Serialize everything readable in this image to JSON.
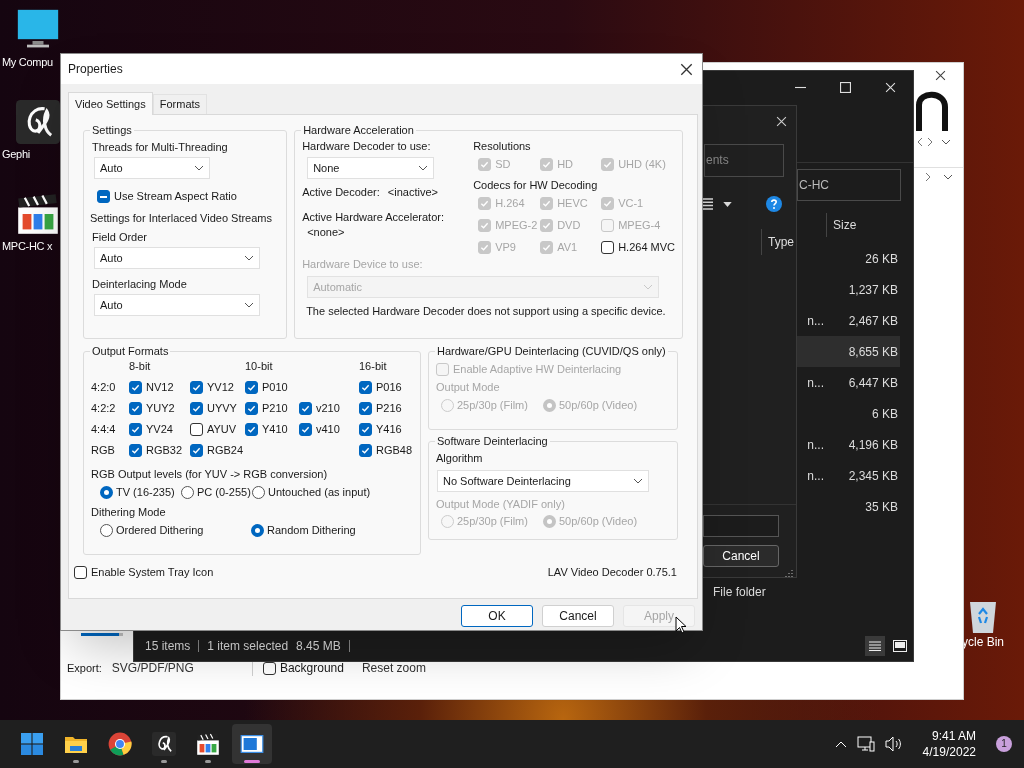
{
  "desktop": {
    "icons": [
      {
        "kind": "monitor",
        "label": "My Compu"
      },
      {
        "kind": "gephi",
        "label": "Gephi"
      },
      {
        "kind": "player",
        "label": "MPC-HC x"
      }
    ],
    "recycle_bin": {
      "label": "ycle Bin"
    }
  },
  "gephi_window": {
    "zoom_slider": {
      "level": 0.9
    },
    "export_label": "Export:",
    "export_value": "SVG/PDF/PNG",
    "background_option": {
      "label": "Background",
      "checked": false
    },
    "reset_zoom": "Reset zoom"
  },
  "explorer_window": {
    "address": "C-HC",
    "size_header": "Size",
    "rows": [
      {
        "size": "26 KB",
        "selected": false
      },
      {
        "size": "1,237 KB",
        "selected": false
      },
      {
        "type": "n...",
        "size": "2,467 KB",
        "selected": false
      },
      {
        "size": "8,655 KB",
        "selected": true
      },
      {
        "type": "n...",
        "size": "6,447 KB",
        "selected": false
      },
      {
        "size": "6 KB",
        "selected": false
      },
      {
        "type": "n...",
        "size": "4,196 KB",
        "selected": false
      },
      {
        "type": "n...",
        "size": "2,345 KB",
        "selected": false
      },
      {
        "size": "35 KB",
        "selected": false
      }
    ],
    "folder_row": {
      "type": "File folder"
    },
    "status": {
      "count": "15 items",
      "selection": "1 item selected",
      "selection_size": "8.45 MB"
    }
  },
  "file_dialog": {
    "search_placeholder": "ents",
    "type_header": "Type",
    "cancel": "Cancel"
  },
  "dialog": {
    "title": "Properties",
    "tabs": [
      {
        "label": "Video Settings",
        "selected": true
      },
      {
        "label": "Formats",
        "selected": false
      }
    ],
    "settings": {
      "title": "Settings",
      "threads": {
        "label": "Threads for Multi-Threading",
        "value": "Auto"
      },
      "stream_aspect": {
        "label": "Use Stream Aspect Ratio",
        "checked": true,
        "indeterminate": true
      },
      "interlaced_title": "Settings for Interlaced Video Streams",
      "field_order": {
        "label": "Field Order",
        "value": "Auto"
      },
      "deint_mode": {
        "label": "Deinterlacing Mode",
        "value": "Auto"
      }
    },
    "hw": {
      "title": "Hardware Acceleration",
      "decoder": {
        "label": "Hardware Decoder to use:",
        "value": "None"
      },
      "active_decoder": {
        "label": "Active Decoder:",
        "value": "<inactive>"
      },
      "active_accelerator": {
        "label": "Active Hardware Accelerator:",
        "value": "<none>"
      },
      "device": {
        "label": "Hardware Device to use:",
        "value": "Automatic",
        "disabled": true
      },
      "note": "The selected Hardware Decoder does not support using a specific device.",
      "resolutions": {
        "title": "Resolutions",
        "items": [
          {
            "label": "SD",
            "checked": true,
            "disabled": true
          },
          {
            "label": "HD",
            "checked": true,
            "disabled": true
          },
          {
            "label": "UHD (4K)",
            "checked": true,
            "disabled": true
          }
        ]
      },
      "codecs": {
        "title": "Codecs for HW Decoding",
        "items": [
          {
            "label": "H.264",
            "checked": true,
            "disabled": true
          },
          {
            "label": "HEVC",
            "checked": true,
            "disabled": true
          },
          {
            "label": "VC-1",
            "checked": true,
            "disabled": true
          },
          {
            "label": "MPEG-2",
            "checked": true,
            "disabled": true
          },
          {
            "label": "DVD",
            "checked": true,
            "disabled": true
          },
          {
            "label": "MPEG-4",
            "checked": false,
            "disabled": true
          },
          {
            "label": "VP9",
            "checked": true,
            "disabled": true
          },
          {
            "label": "AV1",
            "checked": true,
            "disabled": true
          },
          {
            "label": "H.264 MVC",
            "checked": false,
            "disabled": false
          }
        ]
      }
    },
    "output": {
      "title": "Output Formats",
      "bit_headers": [
        "8-bit",
        "10-bit",
        "16-bit"
      ],
      "rows": [
        {
          "label": "4:2:0",
          "cells": [
            {
              "label": "NV12",
              "checked": true
            },
            {
              "label": "YV12",
              "checked": true
            },
            {
              "label": "P010",
              "checked": true
            },
            null,
            {
              "label": "P016",
              "checked": true
            }
          ]
        },
        {
          "label": "4:2:2",
          "cells": [
            {
              "label": "YUY2",
              "checked": true
            },
            {
              "label": "UYVY",
              "checked": true
            },
            {
              "label": "P210",
              "checked": true
            },
            {
              "label": "v210",
              "checked": true
            },
            {
              "label": "P216",
              "checked": true
            }
          ]
        },
        {
          "label": "4:4:4",
          "cells": [
            {
              "label": "YV24",
              "checked": true
            },
            {
              "label": "AYUV",
              "checked": false
            },
            {
              "label": "Y410",
              "checked": true
            },
            {
              "label": "v410",
              "checked": true
            },
            {
              "label": "Y416",
              "checked": true
            }
          ]
        },
        {
          "label": "RGB",
          "cells": [
            {
              "label": "RGB32",
              "checked": true
            },
            {
              "label": "RGB24",
              "checked": true
            },
            null,
            null,
            {
              "label": "RGB48",
              "checked": true
            }
          ]
        }
      ],
      "rgb_levels": {
        "title": "RGB Output levels (for YUV -> RGB conversion)",
        "options": [
          {
            "label": "TV (16-235)",
            "selected": true
          },
          {
            "label": "PC (0-255)",
            "selected": false
          },
          {
            "label": "Untouched (as input)",
            "selected": false
          }
        ]
      },
      "dithering": {
        "title": "Dithering Mode",
        "options": [
          {
            "label": "Ordered Dithering",
            "selected": false
          },
          {
            "label": "Random Dithering",
            "selected": true
          }
        ]
      }
    },
    "hw_deint": {
      "title": "Hardware/GPU Deinterlacing (CUVID/QS only)",
      "adaptive": {
        "label": "Enable Adaptive HW Deinterlacing",
        "checked": false,
        "disabled": true
      },
      "output_mode": {
        "label": "Output Mode",
        "disabled": true,
        "options": [
          {
            "label": "25p/30p (Film)",
            "selected": false
          },
          {
            "label": "50p/60p (Video)",
            "selected": true
          }
        ]
      }
    },
    "sw_deint": {
      "title": "Software Deinterlacing",
      "algorithm": {
        "label": "Algorithm",
        "value": "No Software Deinterlacing"
      },
      "output_mode": {
        "label": "Output Mode (YADIF only)",
        "disabled": true,
        "options": [
          {
            "label": "25p/30p (Film)",
            "selected": false
          },
          {
            "label": "50p/60p (Video)",
            "selected": true
          }
        ]
      }
    },
    "tray_icon": {
      "label": "Enable System Tray Icon",
      "checked": false
    },
    "version": "LAV Video Decoder 0.75.1",
    "buttons": [
      {
        "label": "OK",
        "kind": "default",
        "disabled": false
      },
      {
        "label": "Cancel",
        "kind": "normal",
        "disabled": false
      },
      {
        "label": "Apply",
        "kind": "normal",
        "disabled": true
      }
    ]
  },
  "taskbar": {
    "apps": [
      {
        "kind": "start",
        "running": false,
        "selected": false
      },
      {
        "kind": "folder",
        "running": true,
        "selected": false
      },
      {
        "kind": "chrome",
        "running": false,
        "selected": false
      },
      {
        "kind": "gephi",
        "running": true,
        "selected": false
      },
      {
        "kind": "player",
        "running": true,
        "selected": false
      },
      {
        "kind": "window",
        "running": true,
        "selected": true
      }
    ],
    "time": "9:41 AM",
    "date": "4/19/2022",
    "notifications": "1"
  }
}
